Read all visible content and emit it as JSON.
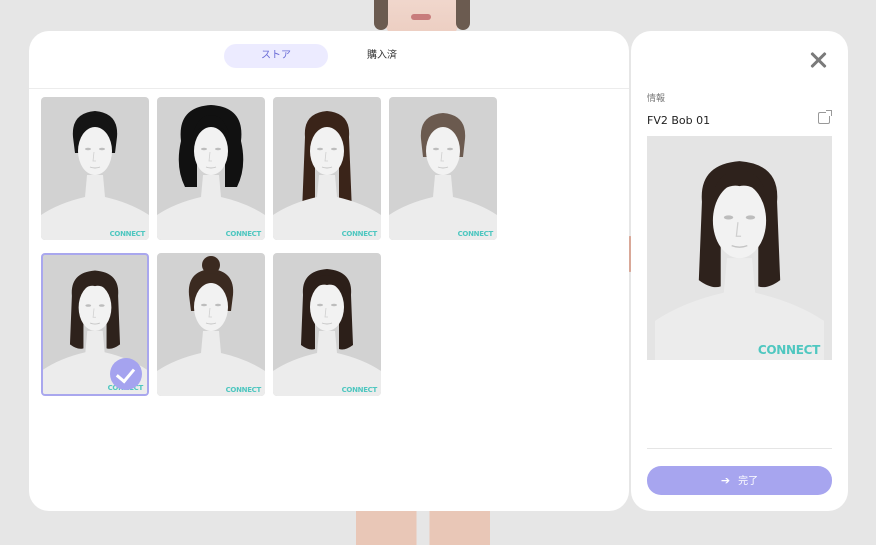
{
  "tabs": [
    {
      "label": "ストア",
      "active": true
    },
    {
      "label": "購入済",
      "active": false
    }
  ],
  "hair_items": [
    {
      "icon": "hair-thumb-braided-updo",
      "hair_color": "#151515",
      "style": "updo",
      "logo": "CONNECT"
    },
    {
      "icon": "hair-thumb-curly-afro",
      "hair_color": "#111111",
      "style": "curly",
      "logo": "CONNECT"
    },
    {
      "icon": "hair-thumb-long-straight",
      "hair_color": "#3a2419",
      "style": "long",
      "logo": "CONNECT"
    },
    {
      "icon": "hair-thumb-short-tied",
      "hair_color": "#6b5a4f",
      "style": "tied",
      "logo": "CONNECT"
    },
    {
      "icon": "hair-thumb-bob-selected",
      "hair_color": "#2e221c",
      "style": "bob",
      "logo": "CONNECT",
      "selected": true
    },
    {
      "icon": "hair-thumb-top-bun",
      "hair_color": "#3b2a20",
      "style": "bun",
      "logo": "CONNECT"
    },
    {
      "icon": "hair-thumb-bob-short",
      "hair_color": "#2c1f19",
      "style": "bob",
      "logo": "CONNECT"
    }
  ],
  "detail": {
    "info_label": "情報",
    "item_name": "FV2 Bob 01",
    "preview_logo": "CONNECT",
    "preview_hair_color": "#2e221c",
    "done_label": "完了",
    "done_icon": "arrow-right-icon",
    "close_icon": "close-icon",
    "share_icon": "external-link-icon"
  },
  "colors": {
    "accent": "#a7a5ef",
    "tab_active_bg": "#ecebff",
    "tab_active_text": "#6a6cd6",
    "logo": "#4fc7c0"
  }
}
